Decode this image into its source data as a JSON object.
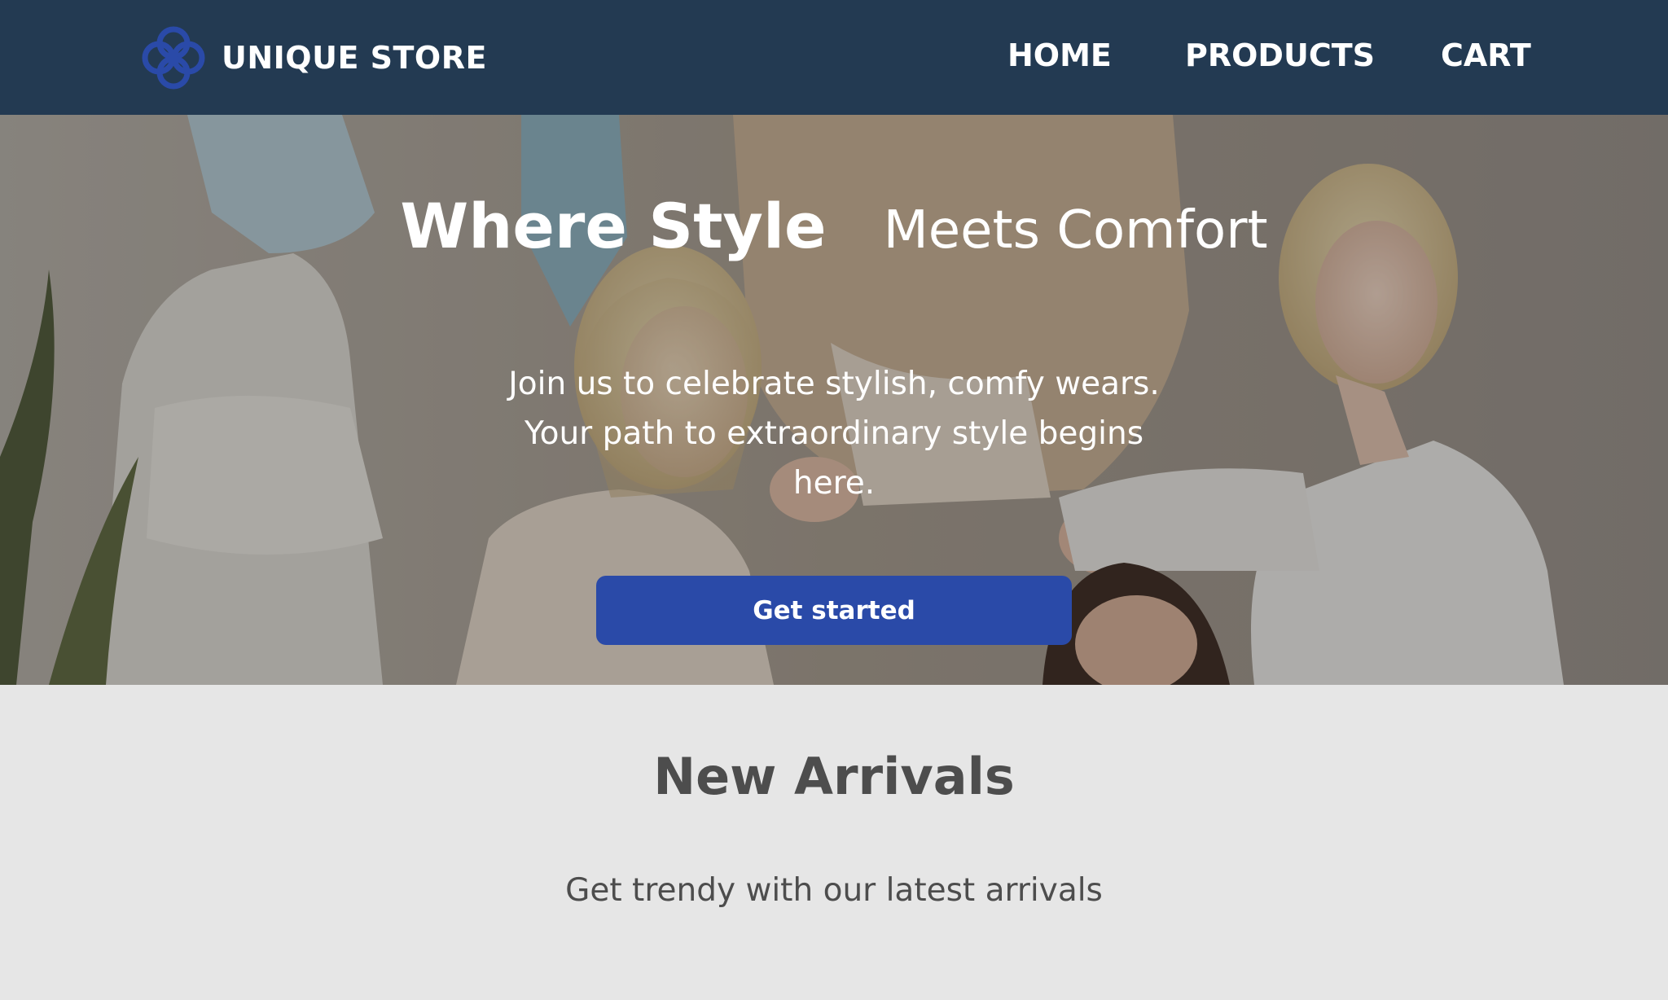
{
  "brand": {
    "name": "UNIQUE STORE",
    "logo_icon": "quatrefoil-logo-icon",
    "logo_color": "#2a4aa8"
  },
  "nav": {
    "home": "HOME",
    "products": "PRODUCTS",
    "cart": "CART",
    "background": "#233a52"
  },
  "hero": {
    "title_strong": "Where Style",
    "title_light": "Meets Comfort",
    "subtitle": "Join us to celebrate stylish, comfy wears. Your path to extraordinary style begins here.",
    "cta_label": "Get started",
    "cta_color": "#2a4aa8"
  },
  "arrivals": {
    "title": "New Arrivals",
    "subtitle": "Get trendy with our latest arrivals"
  }
}
